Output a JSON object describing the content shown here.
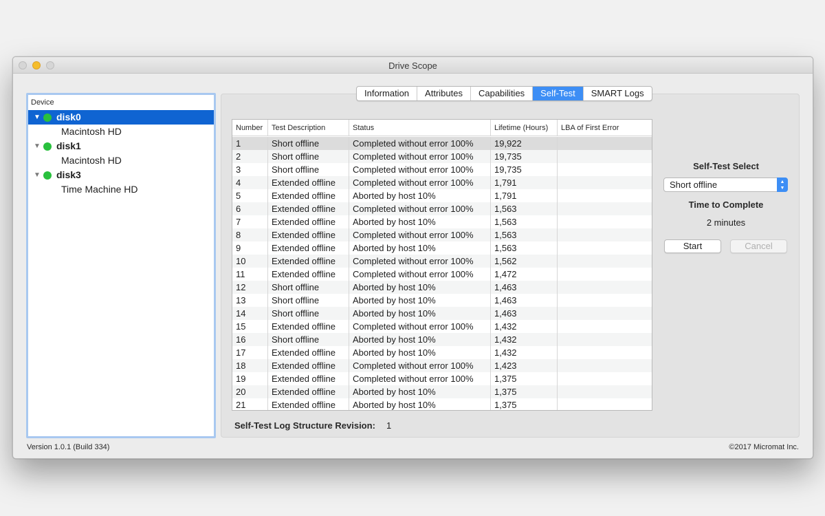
{
  "window": {
    "title": "Drive Scope"
  },
  "sidebar": {
    "header": "Device",
    "disks": [
      {
        "name": "disk0",
        "volume": "Macintosh HD",
        "status_color": "#29c03d"
      },
      {
        "name": "disk1",
        "volume": "Macintosh HD",
        "status_color": "#29c03d"
      },
      {
        "name": "disk3",
        "volume": "Time Machine HD",
        "status_color": "#29c03d"
      }
    ]
  },
  "tabs": [
    "Information",
    "Attributes",
    "Capabilities",
    "Self-Test",
    "SMART Logs"
  ],
  "active_tab": "Self-Test",
  "table": {
    "columns": [
      "Number",
      "Test Description",
      "Status",
      "Lifetime (Hours)",
      "LBA of First Error"
    ],
    "rows": [
      [
        "1",
        "Short offline",
        "Completed without error 100%",
        "19,922",
        ""
      ],
      [
        "2",
        "Short offline",
        "Completed without error 100%",
        "19,735",
        ""
      ],
      [
        "3",
        "Short offline",
        "Completed without error 100%",
        "19,735",
        ""
      ],
      [
        "4",
        "Extended offline",
        "Completed without error 100%",
        "1,791",
        ""
      ],
      [
        "5",
        "Extended offline",
        "Aborted by host 10%",
        "1,791",
        ""
      ],
      [
        "6",
        "Extended offline",
        "Completed without error 100%",
        "1,563",
        ""
      ],
      [
        "7",
        "Extended offline",
        "Aborted by host 10%",
        "1,563",
        ""
      ],
      [
        "8",
        "Extended offline",
        "Completed without error 100%",
        "1,563",
        ""
      ],
      [
        "9",
        "Extended offline",
        "Aborted by host 10%",
        "1,563",
        ""
      ],
      [
        "10",
        "Extended offline",
        "Completed without error 100%",
        "1,562",
        ""
      ],
      [
        "11",
        "Extended offline",
        "Completed without error 100%",
        "1,472",
        ""
      ],
      [
        "12",
        "Short offline",
        "Aborted by host 10%",
        "1,463",
        ""
      ],
      [
        "13",
        "Short offline",
        "Aborted by host 10%",
        "1,463",
        ""
      ],
      [
        "14",
        "Short offline",
        "Aborted by host 10%",
        "1,463",
        ""
      ],
      [
        "15",
        "Extended offline",
        "Completed without error 100%",
        "1,432",
        ""
      ],
      [
        "16",
        "Short offline",
        "Aborted by host 10%",
        "1,432",
        ""
      ],
      [
        "17",
        "Extended offline",
        "Aborted by host 10%",
        "1,432",
        ""
      ],
      [
        "18",
        "Extended offline",
        "Completed without error 100%",
        "1,423",
        ""
      ],
      [
        "19",
        "Extended offline",
        "Completed without error 100%",
        "1,375",
        ""
      ],
      [
        "20",
        "Extended offline",
        "Aborted by host 10%",
        "1,375",
        ""
      ],
      [
        "21",
        "Extended offline",
        "Aborted by host 10%",
        "1,375",
        ""
      ]
    ]
  },
  "revision": {
    "label": "Self-Test Log Structure Revision:",
    "value": "1"
  },
  "controls": {
    "select_label": "Self-Test Select",
    "select_value": "Short offline",
    "time_label": "Time to Complete",
    "time_value": "2 minutes",
    "start_label": "Start",
    "cancel_label": "Cancel"
  },
  "footer": {
    "version": "Version 1.0.1 (Build 334)",
    "copyright": "©2017 Micromat Inc."
  },
  "colors": {
    "accent": "#3d8ef5",
    "selection": "#0f64d2",
    "status_ok": "#29c03d"
  }
}
